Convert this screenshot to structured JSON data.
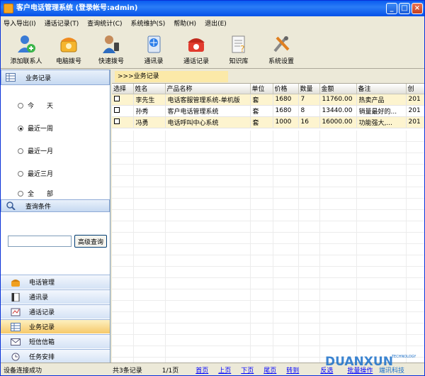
{
  "window": {
    "title": "客户电话管理系统 (登录帐号:admin)",
    "buttons": [
      "_",
      "□",
      "×"
    ]
  },
  "menu": [
    "导入导出(I)",
    "通话记录(T)",
    "查询统计(C)",
    "系统维护(S)",
    "帮助(H)",
    "退出(E)"
  ],
  "toolbar": [
    {
      "label": "添加联系人",
      "icon": "add-contact-icon"
    },
    {
      "label": "电脑拨号",
      "icon": "phone-dial-icon"
    },
    {
      "label": "快速拨号",
      "icon": "quick-dial-icon"
    },
    {
      "label": "通讯录",
      "icon": "address-book-icon"
    },
    {
      "label": "通话记录",
      "icon": "call-log-icon"
    },
    {
      "label": "知识库",
      "icon": "knowledge-icon"
    },
    {
      "label": "系统设置",
      "icon": "settings-icon"
    }
  ],
  "left": {
    "header": "业务记录",
    "radios": [
      {
        "label": "今　　天",
        "checked": false
      },
      {
        "label": "最近一周",
        "checked": true
      },
      {
        "label": "最近一月",
        "checked": false
      },
      {
        "label": "最近三月",
        "checked": false
      },
      {
        "label": "全　　部",
        "checked": false
      }
    ],
    "query_header": "查询条件",
    "query_input": "",
    "query_button": "高级查询",
    "nav": [
      {
        "label": "电话管理",
        "active": false
      },
      {
        "label": "通讯录",
        "active": false
      },
      {
        "label": "通话记录",
        "active": false
      },
      {
        "label": "业务记录",
        "active": true
      },
      {
        "label": "短信信箱",
        "active": false
      },
      {
        "label": "任务安排",
        "active": false
      }
    ]
  },
  "main": {
    "bar_label": ">>>业务记录",
    "columns": [
      "选择",
      "姓名",
      "产品名称",
      "单位",
      "价格",
      "数量",
      "金额",
      "备注",
      "创"
    ],
    "rows": [
      [
        "",
        "李先生",
        "电话客服管理系统-单机版",
        "套",
        "1680",
        "7",
        "11760.00",
        "热卖产品",
        "201"
      ],
      [
        "",
        "孙秀",
        "客户电话管理系统",
        "套",
        "1680",
        "8",
        "13440.00",
        "销量最好的...",
        "201"
      ],
      [
        "",
        "冯勇",
        "电话呼叫中心系统",
        "套",
        "1000",
        "16",
        "16000.00",
        "功能强大,...",
        "201"
      ]
    ]
  },
  "status": {
    "left": "设备连接成功",
    "count": "共3条记录",
    "page": "1/1页",
    "links": [
      "首页",
      "上页",
      "下页",
      "尾页",
      "转到",
      "反选",
      "批量操作"
    ]
  },
  "logo": {
    "text": "DUANXUN",
    "sub": "TECHNOLOGY",
    "cn": "端讯科技"
  }
}
